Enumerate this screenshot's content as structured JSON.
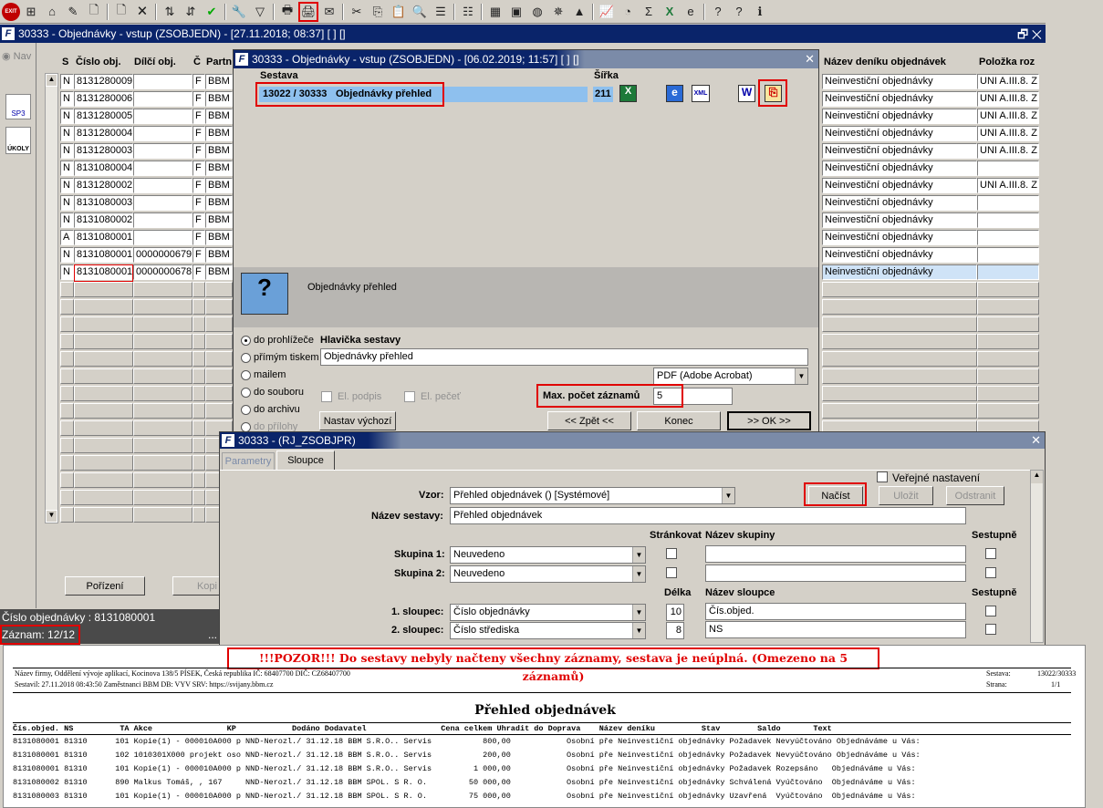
{
  "toolbar": {
    "exit_label": "EXIT",
    "icons": [
      "exit-icon",
      "add-record-icon",
      "home-icon",
      "edit-icon",
      "new-doc-icon",
      "new-doc2-icon",
      "delete-icon",
      "sort-asc-icon",
      "sort-desc-icon",
      "check-icon",
      "tools-icon",
      "filter-icon",
      "print-icon",
      "print-report-icon",
      "mail-icon",
      "cut-icon",
      "copy-icon",
      "paste-icon",
      "zoom-icon",
      "list-icon",
      "list2-icon",
      "calc-icon",
      "calendar-icon",
      "globe-icon",
      "wheel-icon",
      "map-icon",
      "chart-icon",
      "clock-icon",
      "sum-icon",
      "excel-icon",
      "ie-icon",
      "help-icon",
      "help2-icon",
      "info-icon"
    ]
  },
  "main_window": {
    "title": "30333 - Objednávky - vstup (ZSOBJEDN) - [27.11.2018; 08:37] [ ] []",
    "nav_label": "Nav",
    "side_icons": [
      {
        "label": "SP3"
      },
      {
        "label": "ÚKOLY"
      }
    ],
    "columns": {
      "s": "S",
      "cislo": "Číslo obj.",
      "dilci": "Dílčí obj.",
      "c": "Č",
      "partner": "Partn",
      "nazev_deniku": "Název deníku objednávek",
      "polozka": "Položka roz"
    },
    "rows": [
      {
        "s": "N",
        "cislo": "8131280009",
        "dilci": "",
        "c": "F",
        "p": "BBM S",
        "den": "Neinvestiční objednávky",
        "pol": "UNI A.III.8. Z"
      },
      {
        "s": "N",
        "cislo": "8131280006",
        "dilci": "",
        "c": "F",
        "p": "BBM S",
        "den": "Neinvestiční objednávky",
        "pol": "UNI A.III.8. Z"
      },
      {
        "s": "N",
        "cislo": "8131280005",
        "dilci": "",
        "c": "F",
        "p": "BBM S",
        "den": "Neinvestiční objednávky",
        "pol": "UNI A.III.8. Z"
      },
      {
        "s": "N",
        "cislo": "8131280004",
        "dilci": "",
        "c": "F",
        "p": "BBM S",
        "den": "Neinvestiční objednávky",
        "pol": "UNI A.III.8. Z"
      },
      {
        "s": "N",
        "cislo": "8131280003",
        "dilci": "",
        "c": "F",
        "p": "BBM S",
        "den": "Neinvestiční objednávky",
        "pol": "UNI A.III.8. Z"
      },
      {
        "s": "N",
        "cislo": "8131080004",
        "dilci": "",
        "c": "F",
        "p": "BBM S",
        "den": "Neinvestiční objednávky",
        "pol": ""
      },
      {
        "s": "N",
        "cislo": "8131280002",
        "dilci": "",
        "c": "F",
        "p": "BBM S",
        "den": "Neinvestiční objednávky",
        "pol": "UNI A.III.8. Z"
      },
      {
        "s": "N",
        "cislo": "8131080003",
        "dilci": "",
        "c": "F",
        "p": "BBM S",
        "den": "Neinvestiční objednávky",
        "pol": ""
      },
      {
        "s": "N",
        "cislo": "8131080002",
        "dilci": "",
        "c": "F",
        "p": "BBM S",
        "den": "Neinvestiční objednávky",
        "pol": ""
      },
      {
        "s": "A",
        "cislo": "8131080001",
        "dilci": "",
        "c": "F",
        "p": "BBM S",
        "den": "Neinvestiční objednávky",
        "pol": ""
      },
      {
        "s": "N",
        "cislo": "8131080001",
        "dilci": "0000000679",
        "c": "F",
        "p": "BBM S",
        "den": "Neinvestiční objednávky",
        "pol": ""
      },
      {
        "s": "N",
        "cislo": "8131080001",
        "dilci": "0000000678",
        "c": "F",
        "p": "BBM S",
        "den": "Neinvestiční objednávky",
        "pol": ""
      }
    ],
    "porizeni_label": "Pořízení",
    "kopie_label": "Kopi",
    "status_cislo": "Číslo objednávky : 8131080001",
    "status_zaznam": "Záznam: 12/12",
    "status_dots": "..."
  },
  "print_dialog": {
    "title": "30333 - Objednávky - vstup (ZSOBJEDN) - [06.02.2019; 11:57] [ ] []",
    "sestava_label": "Sestava",
    "sirka_label": "Šířka",
    "report_code": "13022 / 30333",
    "report_name": "Objednávky přehled",
    "width_value": "211",
    "preview_caption": "Objednávky přehled",
    "options": [
      {
        "label": "do prohlížeče",
        "on": true
      },
      {
        "label": "přímým tiskem",
        "on": false
      },
      {
        "label": "mailem",
        "on": false
      },
      {
        "label": "do souboru",
        "on": false
      },
      {
        "label": "do archivu",
        "on": false
      },
      {
        "label": "do přílohy",
        "on": false
      }
    ],
    "hlavicka_label": "Hlavička sestavy",
    "hlavicka_value": "Objednávky přehled",
    "format_value": "PDF (Adobe Acrobat)",
    "el_podpis": "El. podpis",
    "el_pecet": "El. pečeť",
    "max_label": "Max. počet záznamů",
    "max_value": "5",
    "nastav_label": "Nastav výchozí",
    "zpet_label": "<< Zpět <<",
    "konec_label": "Konec",
    "ok_label": ">> OK >>"
  },
  "settings_dialog": {
    "title": "30333 - (RJ_ZSOBJPR)",
    "tabs": [
      "Parametry",
      "Sloupce"
    ],
    "verejne_label": "Veřejné nastavení",
    "vzor_label": "Vzor:",
    "vzor_value": "Přehled objednávek  ()  [Systémové]",
    "nacist_label": "Načíst",
    "ulozit_label": "Uložit",
    "odstranit_label": "Odstranit",
    "nazev_sestavy_label": "Název sestavy:",
    "nazev_sestavy_value": "Přehled objednávek",
    "strankovat_label": "Stránkovat",
    "nazev_skupiny_label": "Název skupiny",
    "sestupne_label": "Sestupně",
    "skupina1_label": "Skupina 1:",
    "skupina1_value": "Neuvedeno",
    "skupina2_label": "Skupina 2:",
    "skupina2_value": "Neuvedeno",
    "delka_label": "Délka",
    "nazev_sloupce_label": "Název sloupce",
    "sestupne2_label": "Sestupně",
    "sloupec1_label": "1. sloupec:",
    "sloupec1_value": "Číslo objednávky",
    "sloupec1_len": "10",
    "sloupec1_name": "Čís.objed.",
    "sloupec2_label": "2. sloupec:",
    "sloupec2_value": "Číslo střediska",
    "sloupec2_len": "8",
    "sloupec2_name": "NS"
  },
  "report": {
    "warning": "!!!POZOR!!! Do sestavy nebyly načteny všechny záznamy, sestava je neúplná. (Omezeno na 5 záznamů)",
    "header_left1": "Název firmy, Oddělení vývoje aplikací, Kocinova 138/5 PÍSEK, Česká republika  IČ: 68407700  DIČ: CZ68407700",
    "header_left2": "Sestavil: 27.11.2018 08:43:50 Zaměstnanci BBM  DB: VYV  SRV: https://svijany.bbm.cz",
    "sestava_label": "Sestava:",
    "sestava_value": "13022/30333",
    "strana_label": "Strana:",
    "strana_value": "1/1",
    "title": "Přehled objednávek",
    "col_header": "Čís.objed. NS          TA Akce                KP            Dodáno Dodavatel                Cena celkem Uhradit do Doprava    Název deníku          Stav        Saldo       Text",
    "lines": [
      "8131080001 81310      101 Kopie(1) - 000010A000 p NND-Nerozl./ 31.12.18 BBM S.R.O.. Servis           800,00            Osobní pře Neinvestiční objednávky Požadavek Nevyúčtováno Objednáváme u Vás:",
      "8131080001 81310      102 1010301X000 projekt oso NND-Nerozl./ 31.12.18 BBM S.R.O.. Servis           200,00            Osobní pře Neinvestiční objednávky Požadavek Nevyúčtováno Objednáváme u Vás:",
      "8131080001 81310      101 Kopie(1) - 000010A000 p NND-Nerozl./ 31.12.18 BBM S.R.O.. Servis         1 000,00            Osobní pře Neinvestiční objednávky Požadavek Rozepsáno   Objednáváme u Vás:",
      "8131080002 81310      890 Malkus Tomáš, , 167     NND-Nerozl./ 31.12.18 BBM SPOL. S R. O.         50 000,00            Osobní pře Neinvestiční objednávky Schválená Vyúčtováno  Objednáváme u Vás:",
      "8131080003 81310      101 Kopie(1) - 000010A000 p NND-Nerozl./ 31.12.18 BBM SPOL. S R. O.         75 000,00            Osobní pře Neinvestiční objednávky Uzavřená  Vyúčtováno  Objednáváme u Vás:"
    ]
  }
}
